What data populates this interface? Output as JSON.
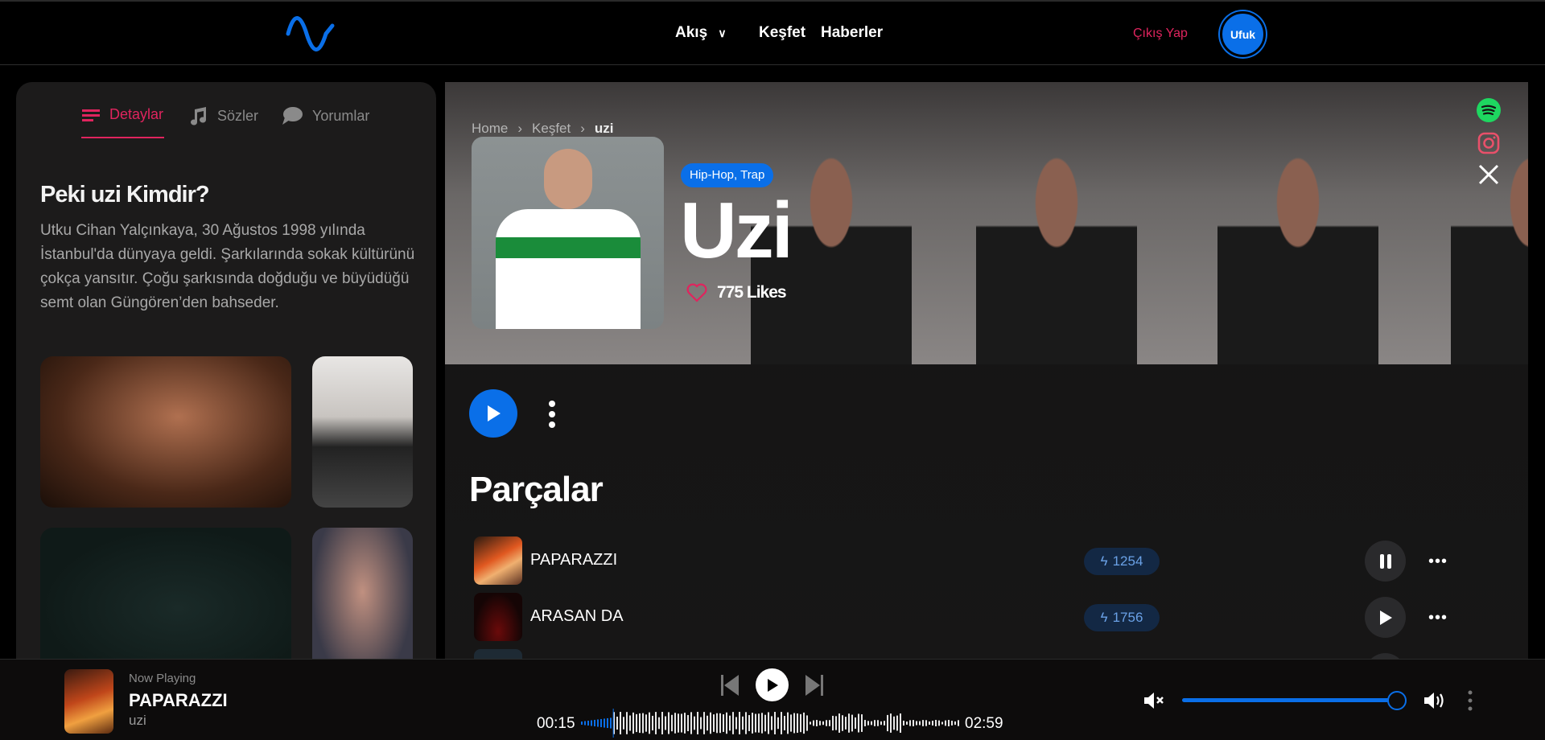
{
  "header": {
    "logo": "wave-logo",
    "nav": [
      {
        "label": "Akış",
        "has_dropdown": true
      },
      {
        "label": "Keşfet"
      },
      {
        "label": "Haberler"
      }
    ],
    "logout_label": "Çıkış Yap",
    "user_initials": "Ufuk"
  },
  "sidebar": {
    "tabs": [
      {
        "label": "Detaylar",
        "icon": "list-icon",
        "active": true
      },
      {
        "label": "Sözler",
        "icon": "music-note-icon"
      },
      {
        "label": "Yorumlar",
        "icon": "comment-icon"
      }
    ],
    "bio_title": "Peki uzi Kimdir?",
    "bio_text": "Utku Cihan Yalçınkaya, 30 Ağustos 1998 yılında İstanbul'da dünyaya geldi. Şarkılarında sokak kültürünü çokça yansıtır. Çoğu şarkısında doğduğu ve büyüdüğü semt olan Güngören’den bahseder."
  },
  "hero": {
    "breadcrumb": [
      "Home",
      "Keşfet",
      "uzi"
    ],
    "genre": "Hip-Hop, Trap",
    "artist_name": "Uzi",
    "likes": "775 Likes",
    "socials": [
      "spotify-icon",
      "instagram-icon",
      "x-icon"
    ]
  },
  "tracks_section": {
    "title": "Parçalar",
    "tracks": [
      {
        "title": "PAPARAZZI",
        "plays": "1254",
        "state": "playing"
      },
      {
        "title": "ARASAN DA",
        "plays": "1756",
        "state": "paused"
      }
    ]
  },
  "player": {
    "label": "Now Playing",
    "title": "PAPARAZZI",
    "artist": "uzi",
    "current_time": "00:15",
    "duration": "02:59",
    "progress": 0.084,
    "volume": 1.0
  },
  "colors": {
    "accent": "#0a6fe8",
    "pink": "#e0245e",
    "spotify": "#1ed760"
  }
}
